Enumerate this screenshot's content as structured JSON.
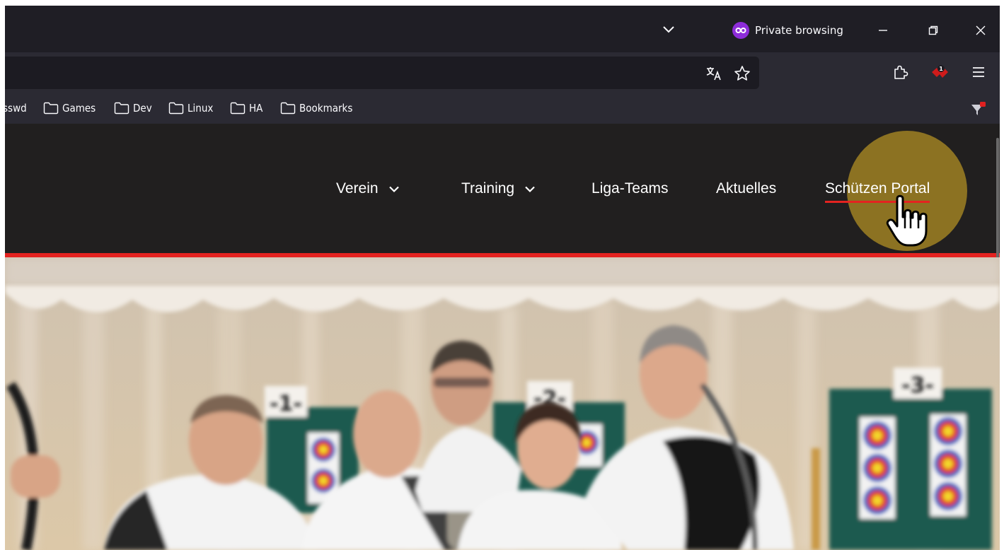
{
  "browser": {
    "private_label": "Private browsing",
    "bookmarks": [
      {
        "label": "sswd"
      },
      {
        "label": "Games"
      },
      {
        "label": "Dev"
      },
      {
        "label": "Linux"
      },
      {
        "label": "HA"
      },
      {
        "label": "Bookmarks"
      }
    ],
    "extension_badge": "1"
  },
  "site": {
    "nav": [
      {
        "label": "Verein",
        "has_dropdown": true
      },
      {
        "label": "Training",
        "has_dropdown": true
      },
      {
        "label": "Liga-Teams",
        "has_dropdown": false
      },
      {
        "label": "Aktuelles",
        "has_dropdown": false
      },
      {
        "label": "Schützen Portal",
        "has_dropdown": false,
        "active": true
      }
    ],
    "lane_numbers": [
      "-1-",
      "-2-",
      "-3-"
    ]
  },
  "colors": {
    "accent_red": "#e42320",
    "header_bg": "#211f1f",
    "private_purple": "#8d2cd9",
    "cursor_halo": "#967a23"
  }
}
